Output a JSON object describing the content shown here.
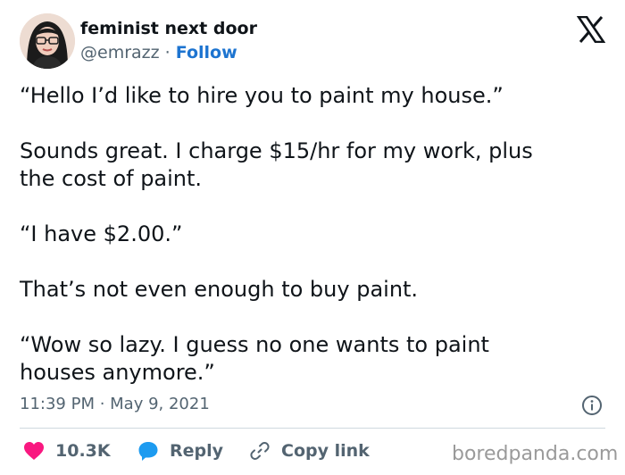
{
  "author": {
    "display_name": "feminist next door",
    "handle": "@emrazz",
    "separator": "·",
    "follow_label": "Follow"
  },
  "icons": {
    "x_logo": "x-logo-icon",
    "info": "info-icon",
    "heart": "heart-icon",
    "reply": "reply-bubble-icon",
    "copy_link": "link-icon"
  },
  "tweet": {
    "paragraphs": [
      "“Hello I’d like to hire you to paint my house.”",
      "Sounds great. I charge $15/hr for my work, plus\nthe cost of paint.",
      "“I have $2.00.”",
      "That’s not even enough to buy paint.",
      "“Wow so lazy. I guess no one wants to paint\nhouses anymore.”"
    ],
    "timestamp": "11:39 PM · May 9, 2021"
  },
  "actions": {
    "likes": "10.3K",
    "reply_label": "Reply",
    "copy_link_label": "Copy link"
  },
  "watermark": "boredpanda.com",
  "colors": {
    "text": "#0f1419",
    "secondary": "#536471",
    "follow": "#1d74d0",
    "heart": "#f91880",
    "reply_bubble": "#1d9bf0",
    "divider": "#cfd9de"
  }
}
